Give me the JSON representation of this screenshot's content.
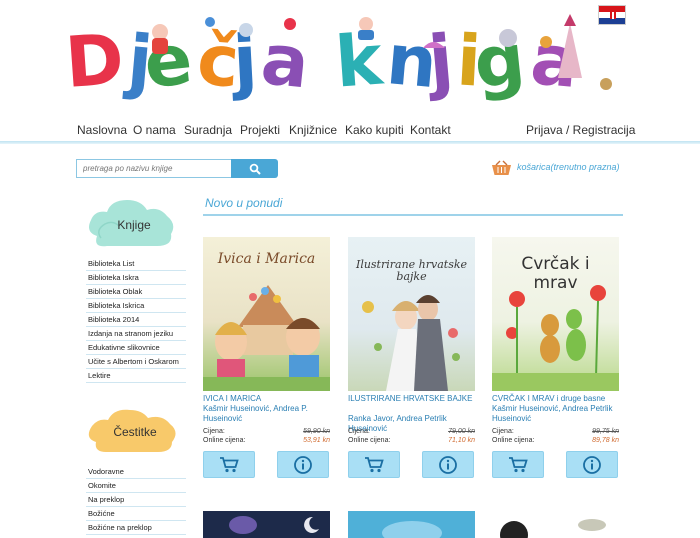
{
  "header": {
    "logo_text": "Dječja knjiga",
    "flag_icon": "croatia-flag-icon"
  },
  "nav": {
    "items": [
      "Naslovna",
      "O nama",
      "Suradnja",
      "Projekti",
      "Knjižnice",
      "Kako kupiti",
      "Kontakt"
    ],
    "login": "Prijava / Registracija"
  },
  "search": {
    "placeholder": "pretraga po nazivu knjige",
    "icon": "search-icon"
  },
  "cart": {
    "label": "košarica(trenutno prazna)",
    "icon": "basket-icon"
  },
  "sidebar": {
    "books_title": "Knjige",
    "books_items": [
      "Biblioteka List",
      "Biblioteka Iskra",
      "Biblioteka Oblak",
      "Biblioteka Iskrica",
      "Biblioteka 2014",
      "Izdanja na stranom jeziku",
      "Edukativne slikovnice",
      "Učite s Albertom i Oskarom",
      "Lektire"
    ],
    "cards_title": "Čestitke",
    "cards_items": [
      "Vodoravne",
      "Okomite",
      "Na preklop",
      "Božićne",
      "Božićne na preklop"
    ]
  },
  "main": {
    "section_title": "Novo u ponudi",
    "price_label": "Cijena:",
    "online_label": "Online cijena:",
    "products": [
      {
        "cover_title": "Ivica i Marica",
        "title": "IVICA I MARICA",
        "author": "Kašmir Huseinović, Andrea P. Huseinović",
        "price": "59,90 kn",
        "online_price": "53,91 kn"
      },
      {
        "cover_title": "Ilustrirane hrvatske bajke",
        "title": "ILUSTRIRANE HRVATSKE BAJKE",
        "author": "Ranka Javor, Andrea Petrlik Huseinović",
        "price": "79,00 kn",
        "online_price": "71,10 kn"
      },
      {
        "cover_title": "Cvrčak i mrav",
        "title": "CVRČAK I MRAV i druge basne",
        "author": "Kašmir Huseinović, Andrea Petrlik Huseinović",
        "price": "99,75 kn",
        "online_price": "89,78 kn"
      }
    ],
    "add_to_cart_icon": "cart-icon",
    "info_icon": "info-icon"
  }
}
